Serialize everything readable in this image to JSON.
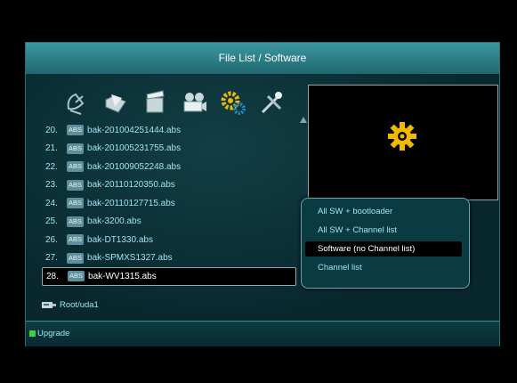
{
  "window": {
    "title": "File List / Software"
  },
  "toolbar_icons": [
    {
      "icon": "satellite-dish-icon"
    },
    {
      "icon": "folder-icon"
    },
    {
      "icon": "clapperboard-icon"
    },
    {
      "icon": "camera-icon"
    },
    {
      "icon": "gears-icon"
    },
    {
      "icon": "tools-icon"
    }
  ],
  "files": [
    {
      "num": "20.",
      "badge": "ABS",
      "name": "bak-201004251444.abs"
    },
    {
      "num": "21.",
      "badge": "ABS",
      "name": "bak-201005231755.abs"
    },
    {
      "num": "22.",
      "badge": "ABS",
      "name": "bak-201009052248.abs"
    },
    {
      "num": "23.",
      "badge": "ABS",
      "name": "bak-20110120350.abs"
    },
    {
      "num": "24.",
      "badge": "ABS",
      "name": "bak-20110127715.abs"
    },
    {
      "num": "25.",
      "badge": "ABS",
      "name": "bak-3200.abs"
    },
    {
      "num": "26.",
      "badge": "ABS",
      "name": "bak-DT1330.abs"
    },
    {
      "num": "27.",
      "badge": "ABS",
      "name": "bak-SPMXS1327.abs"
    },
    {
      "num": "28.",
      "badge": "ABS",
      "name": "bak-WV1315.abs"
    }
  ],
  "path": "Root/uda1",
  "legend": {
    "green_label": "Upgrade"
  },
  "upgrade_menu": {
    "items": [
      {
        "label": "All SW + bootloader"
      },
      {
        "label": "All SW + Channel list"
      },
      {
        "label": "Software (no Channel list)"
      },
      {
        "label": "Channel list"
      }
    ],
    "selected_index": 2
  },
  "colors": {
    "accent": "#3c97a0",
    "gear": "#f0b800",
    "green_key": "#37d43e"
  }
}
